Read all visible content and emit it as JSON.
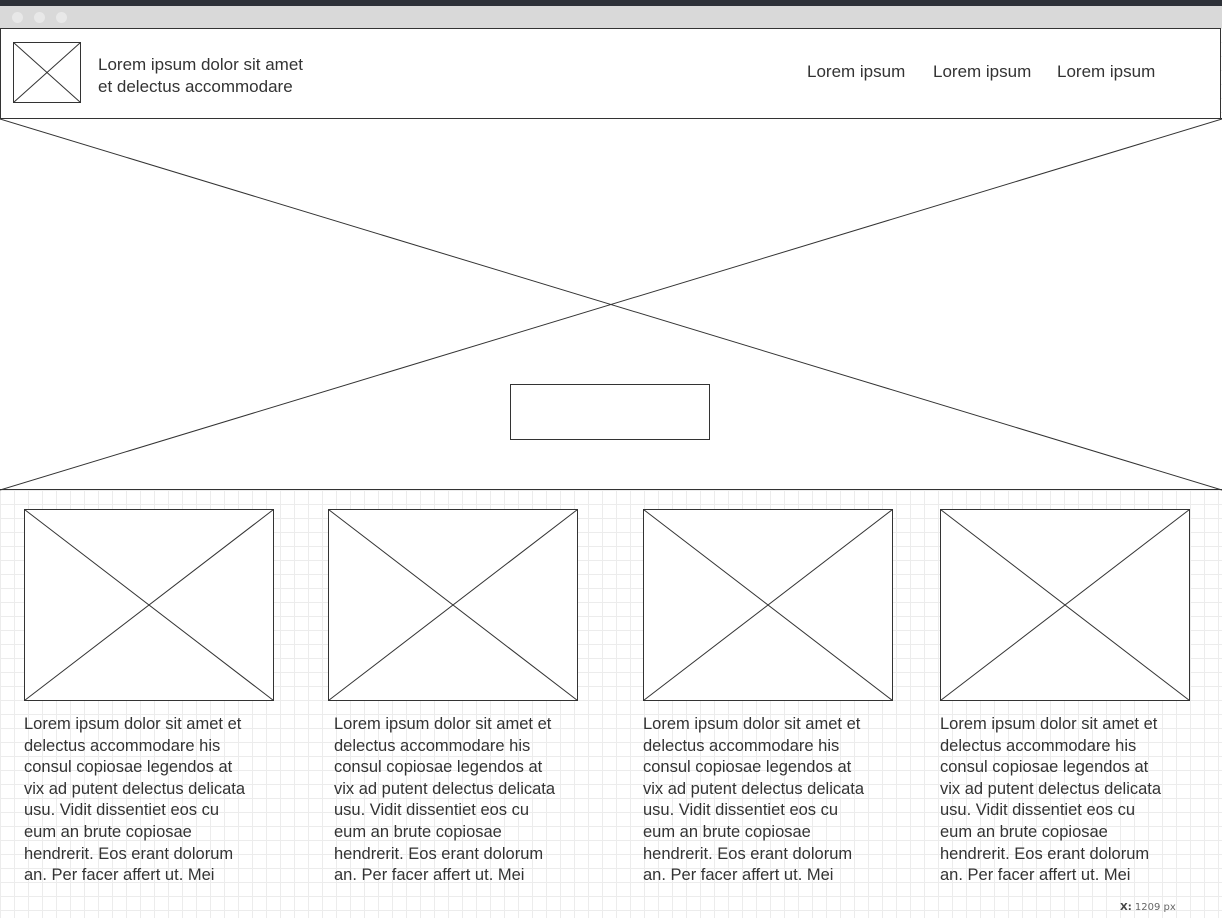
{
  "header": {
    "tagline_line1": "Lorem ipsum dolor sit amet",
    "tagline_line2": "et delectus accommodare",
    "nav": [
      "Lorem ipsum",
      "Lorem ipsum",
      "Lorem ipsum"
    ]
  },
  "hero": {
    "button_label": ""
  },
  "cards": [
    {
      "lines": [
        "Lorem ipsum dolor sit amet et",
        "delectus accommodare his",
        "consul copiosae legendos at",
        "vix ad putent delectus delicata",
        "usu. Vidit dissentiet eos cu",
        "eum an brute copiosae",
        "hendrerit. Eos erant dolorum",
        "an. Per facer affert ut. Mei"
      ]
    },
    {
      "lines": [
        "Lorem ipsum dolor sit amet et",
        "delectus accommodare his",
        "consul copiosae legendos at",
        "vix ad putent delectus delicata",
        "usu. Vidit dissentiet eos cu",
        "eum an brute copiosae",
        "hendrerit. Eos erant dolorum",
        "an. Per facer affert ut. Mei"
      ]
    },
    {
      "lines": [
        "Lorem ipsum dolor sit amet et",
        "delectus accommodare his",
        "consul copiosae legendos at",
        "vix ad putent delectus delicata",
        "usu. Vidit dissentiet eos cu",
        "eum an brute copiosae",
        "hendrerit. Eos erant dolorum",
        "an. Per facer affert ut. Mei"
      ]
    },
    {
      "lines": [
        "Lorem ipsum dolor sit amet et",
        "delectus accommodare his",
        "consul copiosae legendos at",
        "vix ad putent delectus delicata",
        "usu. Vidit dissentiet eos cu",
        "eum an brute copiosae",
        "hendrerit. Eos erant dolorum",
        "an. Per facer affert ut. Mei"
      ]
    }
  ],
  "status": {
    "coord_label": "X:",
    "coord_value": "1209 px"
  }
}
